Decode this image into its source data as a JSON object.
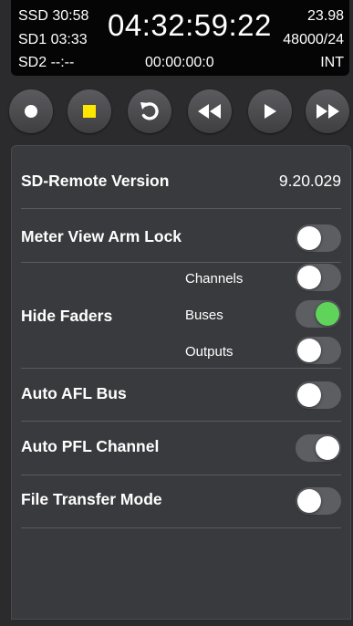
{
  "status": {
    "ssd": "SSD 30:58",
    "sd1": "SD1 03:33",
    "sd2": "SD2 --:--",
    "timecode": "04:32:59:22",
    "frame_rate": "23.98",
    "sample_rate": "48000/24",
    "sub_timecode": "00:00:00:0",
    "sync": "INT"
  },
  "transport": {
    "buttons": [
      "record-icon",
      "stop-icon",
      "loop-icon",
      "rewind-icon",
      "play-icon",
      "fast-forward-icon"
    ],
    "stop_color": "#ffe600"
  },
  "settings": {
    "version_label": "SD-Remote Version",
    "version_value": "9.20.029",
    "meter_view_arm_lock": {
      "label": "Meter View Arm Lock",
      "on": false
    },
    "hide_faders": {
      "label": "Hide Faders",
      "channels": {
        "label": "Channels",
        "on": false
      },
      "buses": {
        "label": "Buses",
        "on": true,
        "color": "#5fd35a"
      },
      "outputs": {
        "label": "Outputs",
        "on": false
      }
    },
    "auto_afl_bus": {
      "label": "Auto AFL Bus",
      "on": false
    },
    "auto_pfl_channel": {
      "label": "Auto PFL Channel",
      "on": true
    },
    "file_transfer_mode": {
      "label": "File Transfer Mode",
      "on": false
    }
  }
}
